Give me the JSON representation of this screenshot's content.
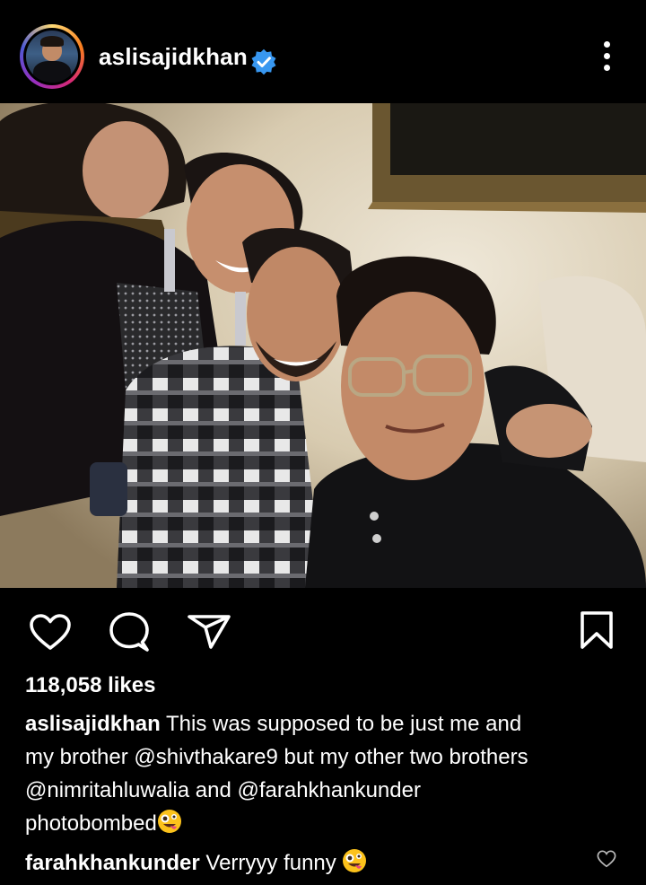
{
  "post": {
    "username": "aslisajidkhan",
    "verified": true,
    "likes_text": "118,058 likes",
    "caption": {
      "author": "aslisajidkhan",
      "line1": " This was supposed to be just me and",
      "line2": "my brother @shivthakare9 but my other two brothers",
      "line3": "@nimritahluwalia and @farahkhankunder",
      "line4": "photobombed"
    },
    "comment": {
      "author": "farahkhankunder",
      "text": " Verryyy funny "
    }
  },
  "icons": {
    "like": "heart-icon",
    "comment": "comment-icon",
    "share": "send-icon",
    "save": "bookmark-icon",
    "more": "more-vertical-icon",
    "emoji": "zany-face-emoji"
  },
  "colors": {
    "background": "#000000",
    "text": "#ffffff",
    "verified": "#3897f0"
  }
}
